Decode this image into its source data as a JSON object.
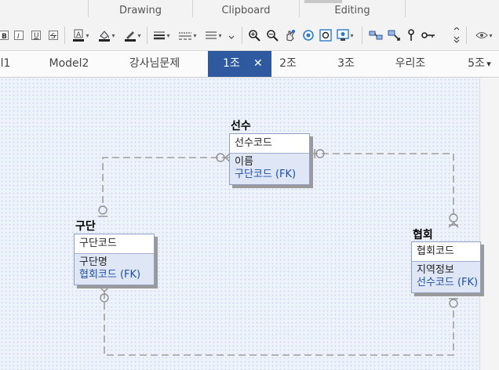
{
  "ribbon": {
    "groups": [
      "Drawing",
      "Clipboard",
      "Editing"
    ]
  },
  "tabs": [
    {
      "label": "l1"
    },
    {
      "label": "Model2"
    },
    {
      "label": "강사님문제"
    },
    {
      "label": "1조",
      "active": true,
      "close": "✕"
    },
    {
      "label": "2조"
    },
    {
      "label": "3조"
    },
    {
      "label": "우리조"
    },
    {
      "label": "5조"
    }
  ],
  "tab_overflow": "▾",
  "entities": {
    "player": {
      "title": "선수",
      "pk": "선수코드",
      "attrs": [
        {
          "text": "이름"
        },
        {
          "text": "구단코드 (FK)"
        }
      ]
    },
    "club": {
      "title": "구단",
      "pk": "구단코드",
      "attrs": [
        {
          "text": "구단명"
        },
        {
          "text": "협회코드 (FK)"
        }
      ]
    },
    "association": {
      "title": "협회",
      "pk": "협회코드",
      "attrs": [
        {
          "text": "지역정보"
        },
        {
          "text": "선수코드 (FK)"
        }
      ]
    }
  },
  "colors": {
    "accent": "#2f5aa0",
    "fk_text": "#1d4fa8",
    "canvas": "#eef3fb",
    "entity_attr_bg": "#dfe6f6",
    "relation_line": "#a0a0a0"
  }
}
